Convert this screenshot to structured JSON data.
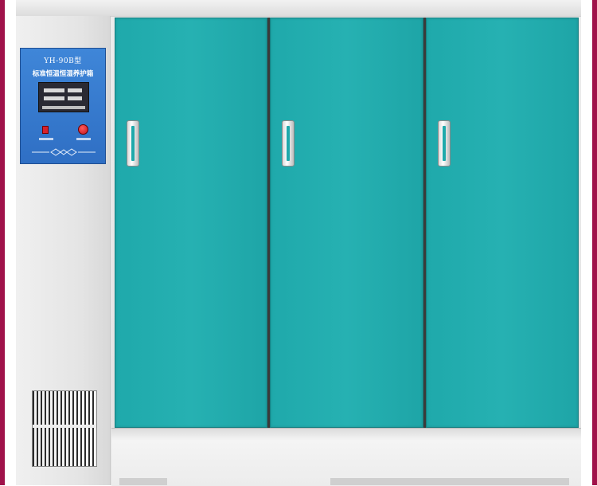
{
  "control_panel": {
    "model": "YH-90B型",
    "product_name": "标准恒温恒湿养护箱"
  },
  "doors": [
    {
      "label": "Left door"
    },
    {
      "label": "Middle door"
    },
    {
      "label": "Right door"
    }
  ],
  "colors": {
    "door": "#26b1b2",
    "panel": "#3f86d8",
    "frame": "#a0124a",
    "cabinet": "#e6e6e6"
  },
  "icons": [
    "door-handle-icon",
    "power-switch-icon",
    "power-button-icon",
    "vent-grille-icon"
  ]
}
